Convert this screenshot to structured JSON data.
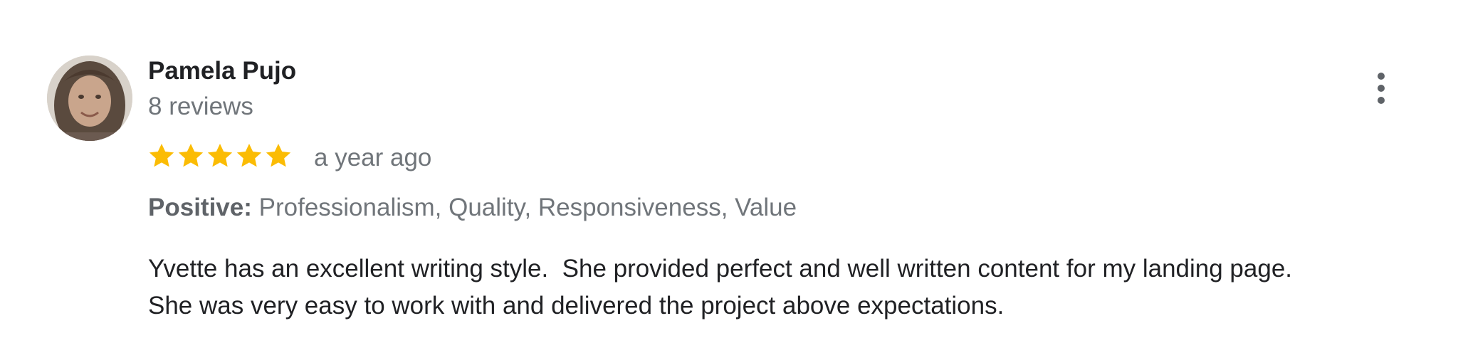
{
  "review": {
    "author_name": "Pamela Pujo",
    "author_reviews": "8 reviews",
    "rating": 5,
    "rating_max": 5,
    "date": "a year ago",
    "attributes": {
      "label": "Positive:",
      "values": "Professionalism, Quality, Responsiveness, Value"
    },
    "text_lines": [
      "Yvette has an excellent writing style.  She provided perfect and well written content for my landing page.",
      "She was very easy to work with and delivered the project above expectations."
    ],
    "icons": {
      "avatar": "profile-photo",
      "star": "star-icon",
      "more": "more-vert-icon"
    }
  },
  "colors": {
    "star": "#fbbc04",
    "name": "#202124",
    "secondary": "#70757a",
    "label": "#5f6368",
    "body": "#202124"
  }
}
